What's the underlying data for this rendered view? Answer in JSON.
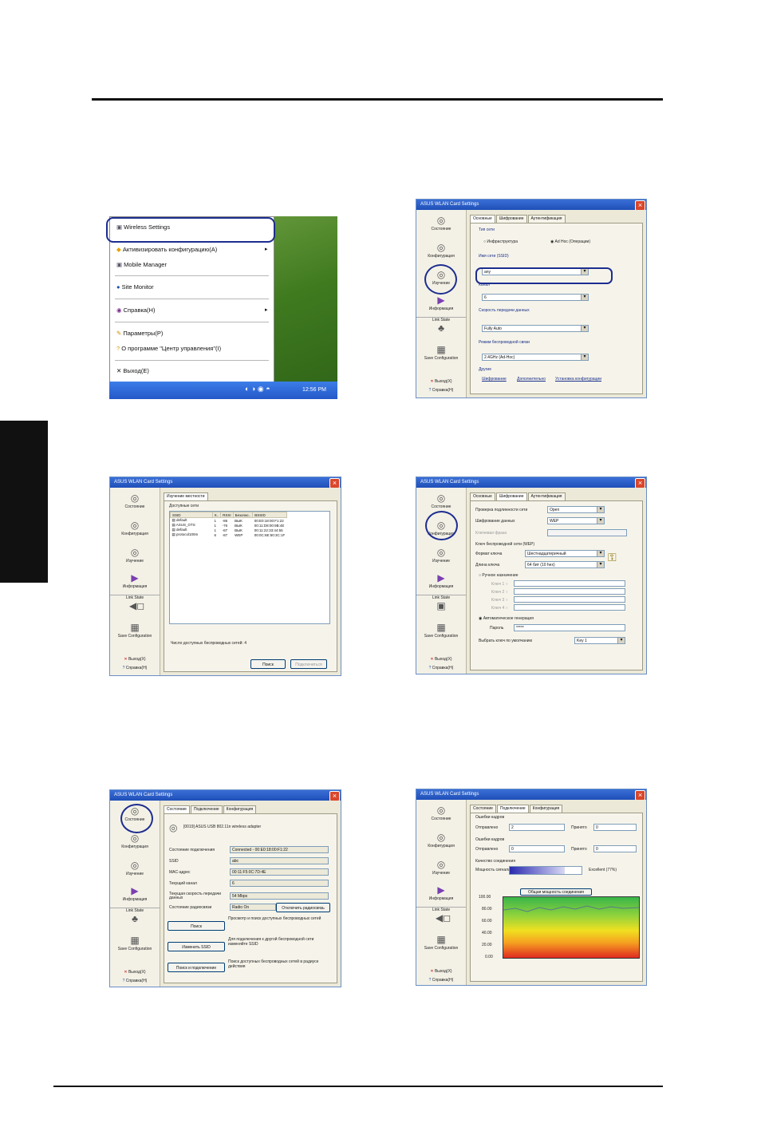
{
  "screenshot1": {
    "menu_items": [
      "Wireless Settings",
      "Активизировать конфигурацию(A)",
      "Mobile Manager",
      "Site Monitor",
      "Справка(H)",
      "Параметры(P)",
      "О программе \"Центр управления\"(I)",
      "Выход(E)"
    ],
    "clock": "12:56 PM"
  },
  "window_title": "ASUS WLAN Card Settings",
  "nav": {
    "status": "Состояние",
    "connection": "Конфигурация",
    "survey": "Изучение",
    "info": "Информация",
    "link_state": "Link State",
    "save_config": "Save Configuration",
    "exit": "Выход(X)",
    "help": "Справка(H)"
  },
  "screenshot2": {
    "tabs": [
      "Основные",
      "Шифрование",
      "Аутентификация"
    ],
    "network_type_label": "Тип сети",
    "opt_infrastructure": "Инфраструктура",
    "opt_adhoc": "Ad Hoc (Операции)",
    "ssid_label": "Имя сети (SSID)",
    "ssid_value": "any",
    "channel_label": "Канал",
    "channel_value": "6",
    "rate_label": "Скорость передачи данных",
    "rate_value": "Fully Auto",
    "mode_label": "Режим беспроводной связи",
    "mode_value": "2.4GHz (Ad-Hoc)",
    "other_label": "Другие",
    "links": [
      "Шифрование",
      "Дополнительно",
      "Установка конфигурации"
    ]
  },
  "screenshot3": {
    "tab": "Изучение местности",
    "section_label": "Доступные сети",
    "columns": [
      "SSID",
      "К..",
      "RSSI",
      "Безопас..",
      "BSSID"
    ],
    "rows": [
      [
        "default",
        "1",
        "-86",
        "ВЫК",
        "00:E0:18:00:F1:22"
      ],
      [
        "ASUS_OTS",
        "1",
        "-76",
        "ВЫК",
        "00:11:D8:00:9B:4E"
      ],
      [
        "default",
        "1",
        "-87",
        "ВЫК",
        "00:11:22:33:44:55"
      ],
      [
        "protocol100m",
        "6",
        "-87",
        "WEP",
        "00:0C:6E:50:3C:1F"
      ]
    ],
    "count_text": "Число доступных беспроводных сетей: 4",
    "btn_search": "Поиск",
    "btn_connect": "Подключиться"
  },
  "screenshot4": {
    "tabs": [
      "Основные",
      "Шифрование",
      "Аутентификация"
    ],
    "auth_label": "Проверка подлинности сети",
    "auth_value": "Open",
    "enc_label": "Шифрование данных",
    "enc_value": "WEP",
    "passphrase_label": "Ключевая фраза",
    "key_group_label": "Ключ беспроводной сети (WEP)",
    "key_format_label": "Формат ключа",
    "key_format_value": "Шестнадцатеричный",
    "key_length_label": "Длина ключа",
    "key_length_value": "64 бит (10 hex)",
    "manual_label": "Ручное назначение",
    "key_labels": [
      "Ключ 1",
      "Ключ 2",
      "Ключ 3",
      "Ключ 4"
    ],
    "auto_label": "Автоматическое генерация",
    "password_label": "Пароль",
    "password_value": "*****",
    "default_key_label": "Выбрать ключ по умолчанию",
    "default_key_value": "Key 1"
  },
  "screenshot5": {
    "tabs": [
      "Состояние",
      "Подключение",
      "Конфигурация"
    ],
    "device": "[0019] ASUS USB 802.11n wireless adapter",
    "rows": [
      {
        "label": "Состояние подключения",
        "value": "Connected - 00:E0:18:00:F1:22"
      },
      {
        "label": "SSID",
        "value": "abc"
      },
      {
        "label": "MAC-адрес",
        "value": "00:11:F5:0C:7D:4E"
      },
      {
        "label": "Текущий канал",
        "value": "6"
      },
      {
        "label": "Текущая скорость передачи данных",
        "value": "54 Mbps"
      },
      {
        "label": "Состояние радиосвязи",
        "value": "Radio On"
      }
    ],
    "btn_radio": "Отключить радиосвязь",
    "buttons": [
      "Поиск",
      "Изменить SSID",
      "Поиск и подключение"
    ],
    "descriptions": [
      "Просмотр и поиск доступных беспроводных сетей",
      "Для подключения к другой беспроводной сети изменяйте SSID",
      "Поиск доступных беспроводных сетей в радиусе действия"
    ]
  },
  "screenshot6": {
    "tabs": [
      "Состояние",
      "Подключение",
      "Конфигурация"
    ],
    "group_errors1": "Ошибки кадров",
    "sent_label": "Отправлено",
    "sent_value": "2",
    "recv_label": "Принято",
    "recv_value": "0",
    "group_errors2": "Ошибки кадров",
    "sent2_value": "0",
    "recv2_value": "0",
    "quality_group": "Качество соединения",
    "signal_label": "Мощность сигнала",
    "signal_text": "Excellent (77%)",
    "signal_pct": 77,
    "graph_button": "Общая мощность соединения",
    "y_ticks": [
      "100.00",
      "80.00",
      "60.00",
      "40.00",
      "20.00",
      "0.00"
    ]
  }
}
